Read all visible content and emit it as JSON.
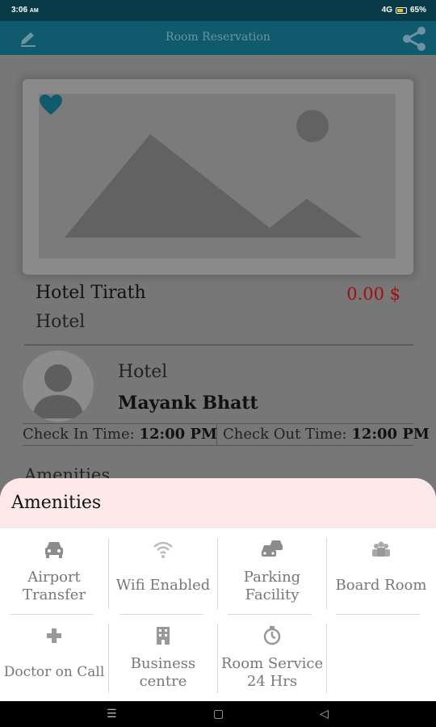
{
  "status": {
    "time": "3:06",
    "time_suffix": "AM",
    "signal": "4G",
    "battery": "65%"
  },
  "app_bar": {
    "title": "Room Reservation",
    "edit_icon": "edit-icon",
    "share_icon": "share-icon"
  },
  "hotel": {
    "name": "Hotel Tirath",
    "type": "Hotel",
    "price": "0.00 $",
    "host_label": "Hotel",
    "host_name": "Mayank Bhatt",
    "check_in_label": "Check In Time:",
    "check_in_value": "12:00 PM",
    "check_out_label": "Check Out Time:",
    "check_out_value": "12:00 PM",
    "amenities_heading": "Amenities"
  },
  "sheet": {
    "title": "Amenities",
    "items": [
      {
        "label_line1": "Airport",
        "label_line2": "Transfer",
        "icon": "car-icon"
      },
      {
        "label_line1": "Wifi Enabled",
        "label_line2": "",
        "icon": "wifi-icon"
      },
      {
        "label_line1": "Parking",
        "label_line2": "Facility",
        "icon": "parking-cars-icon"
      },
      {
        "label_line1": "Board Room",
        "label_line2": "",
        "icon": "people-icon"
      },
      {
        "label_line1": "Doctor on Call",
        "label_line2": "",
        "icon": "plus-icon"
      },
      {
        "label_line1": "Business",
        "label_line2": "centre",
        "icon": "building-icon"
      },
      {
        "label_line1": "Room Service",
        "label_line2": "24 Hrs",
        "icon": "timer-icon"
      }
    ]
  },
  "colors": {
    "app_bar": "#0f5a6c",
    "heart": "#0f5a6c",
    "price": "#a10f10",
    "sheet_header": "#fce8e8"
  }
}
